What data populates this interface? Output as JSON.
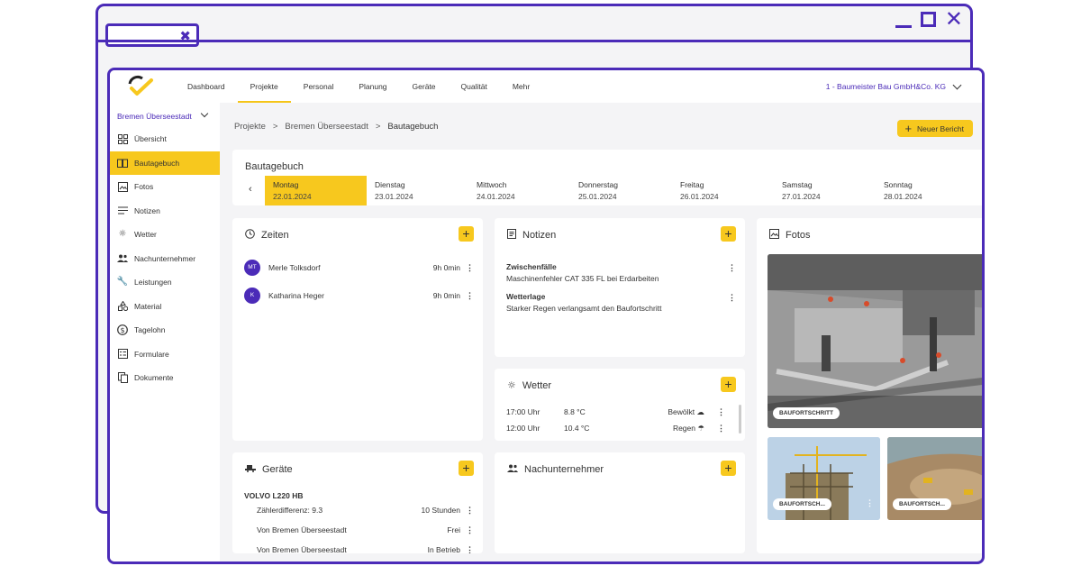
{
  "nav": {
    "items": [
      "Dashboard",
      "Projekte",
      "Personal",
      "Planung",
      "Geräte",
      "Qualität",
      "Mehr"
    ],
    "active": "Projekte",
    "company": "1 - Baumeister Bau GmbH&Co. KG"
  },
  "sidebar": {
    "project": "Bremen Überseestadt",
    "items": [
      {
        "label": "Übersicht",
        "icon": "dashboard-icon"
      },
      {
        "label": "Bautagebuch",
        "icon": "book-icon"
      },
      {
        "label": "Fotos",
        "icon": "photo-icon"
      },
      {
        "label": "Notizen",
        "icon": "notes-icon"
      },
      {
        "label": "Wetter",
        "icon": "sun-icon"
      },
      {
        "label": "Nachunternehmer",
        "icon": "people-icon"
      },
      {
        "label": "Leistungen",
        "icon": "wrench-icon"
      },
      {
        "label": "Material",
        "icon": "shapes-icon"
      },
      {
        "label": "Tagelohn",
        "icon": "dollar-icon"
      },
      {
        "label": "Formulare",
        "icon": "form-icon"
      },
      {
        "label": "Dokumente",
        "icon": "documents-icon"
      }
    ],
    "active": "Bautagebuch"
  },
  "breadcrumb": {
    "items": [
      "Projekte",
      "Bremen Überseestadt",
      "Bautagebuch"
    ],
    "separator": ">"
  },
  "new_report_label": "Neuer Bericht",
  "week": {
    "title": "Bautagebuch",
    "days": [
      {
        "name": "Montag",
        "date": "22.01.2024"
      },
      {
        "name": "Dienstag",
        "date": "23.01.2024"
      },
      {
        "name": "Mittwoch",
        "date": "24.01.2024"
      },
      {
        "name": "Donnerstag",
        "date": "25.01.2024"
      },
      {
        "name": "Freitag",
        "date": "26.01.2024"
      },
      {
        "name": "Samstag",
        "date": "27.01.2024"
      },
      {
        "name": "Sonntag",
        "date": "28.01.2024"
      }
    ],
    "active_day": "Montag"
  },
  "zeiten": {
    "title": "Zeiten",
    "entries": [
      {
        "initials": "MT",
        "name": "Merle Tolksdorf",
        "duration": "9h 0min"
      },
      {
        "initials": "K",
        "name": "Katharina Heger",
        "duration": "9h 0min"
      }
    ]
  },
  "notizen": {
    "title": "Notizen",
    "entries": [
      {
        "heading": "Zwischenfälle",
        "text": "Maschinenfehler CAT 335 FL bei Erdarbeiten"
      },
      {
        "heading": "Wetterlage",
        "text": "Starker Regen verlangsamt den Baufortschritt"
      }
    ]
  },
  "wetter": {
    "title": "Wetter",
    "entries": [
      {
        "time": "17:00 Uhr",
        "temp": "8.8 °C",
        "condition": "Bewölkt"
      },
      {
        "time": "12:00 Uhr",
        "temp": "10.4 °C",
        "condition": "Regen"
      }
    ]
  },
  "fotos": {
    "title": "Fotos",
    "badges": [
      "BAUFORTSCHRITT",
      "BAUFORTSCH...",
      "BAUFORTSCH..."
    ]
  },
  "geraete": {
    "title": "Geräte",
    "machine": "VOLVO L220 HB",
    "rows": [
      {
        "label": "Zählerdifferenz: 9.3",
        "value": "10 Stunden"
      },
      {
        "label": "Von Bremen Überseestadt",
        "value": "Frei"
      },
      {
        "label": "Von Bremen Überseestadt",
        "value": "In Betrieb"
      }
    ]
  },
  "nachunternehmer": {
    "title": "Nachunternehmer"
  },
  "colors": {
    "accent": "#f7c81e",
    "brand": "#4b2bb8",
    "background": "#f4f4f6"
  }
}
